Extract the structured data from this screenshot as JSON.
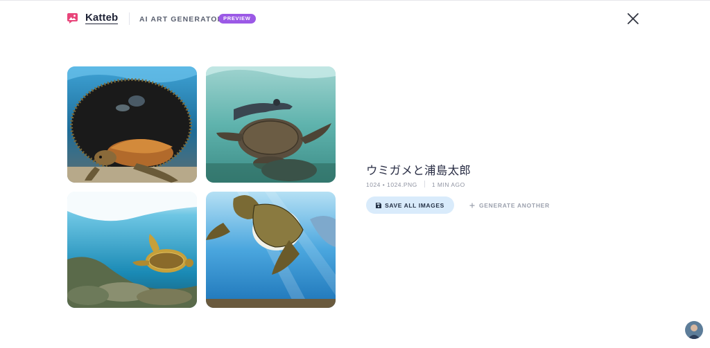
{
  "header": {
    "brand": "Katteb",
    "app_title": "AI ART GENERATOR",
    "badge": "PREVIEW",
    "logo_icon": "image-chat-icon",
    "close_icon": "close-icon",
    "brand_color": "#e8457a",
    "badge_color": "#9b59e6"
  },
  "images": [
    {
      "label": "sea-turtle-reef-image",
      "alt": "Sea turtle resting in front of a round reef rock with fish"
    },
    {
      "label": "sea-turtle-diver-image",
      "alt": "Turtle swimming above reef with diver at the surface"
    },
    {
      "label": "sea-turtle-shallow-image",
      "alt": "Turtle gliding over coral in shallow blue water"
    },
    {
      "label": "sea-turtle-sunrays-image",
      "alt": "Turtle swimming toward camera under sun rays"
    }
  ],
  "result": {
    "title": "ウミガメと浦島太郎",
    "meta_size": "1024 • 1024.PNG",
    "meta_time": "1 MIN AGO",
    "save_label": "SAVE ALL IMAGES",
    "save_icon": "floppy-disk-icon",
    "generate_label": "GENERATE ANOTHER",
    "generate_icon": "plus-icon",
    "accent": "#d9ebfb"
  },
  "user": {
    "avatar": "user-avatar"
  }
}
